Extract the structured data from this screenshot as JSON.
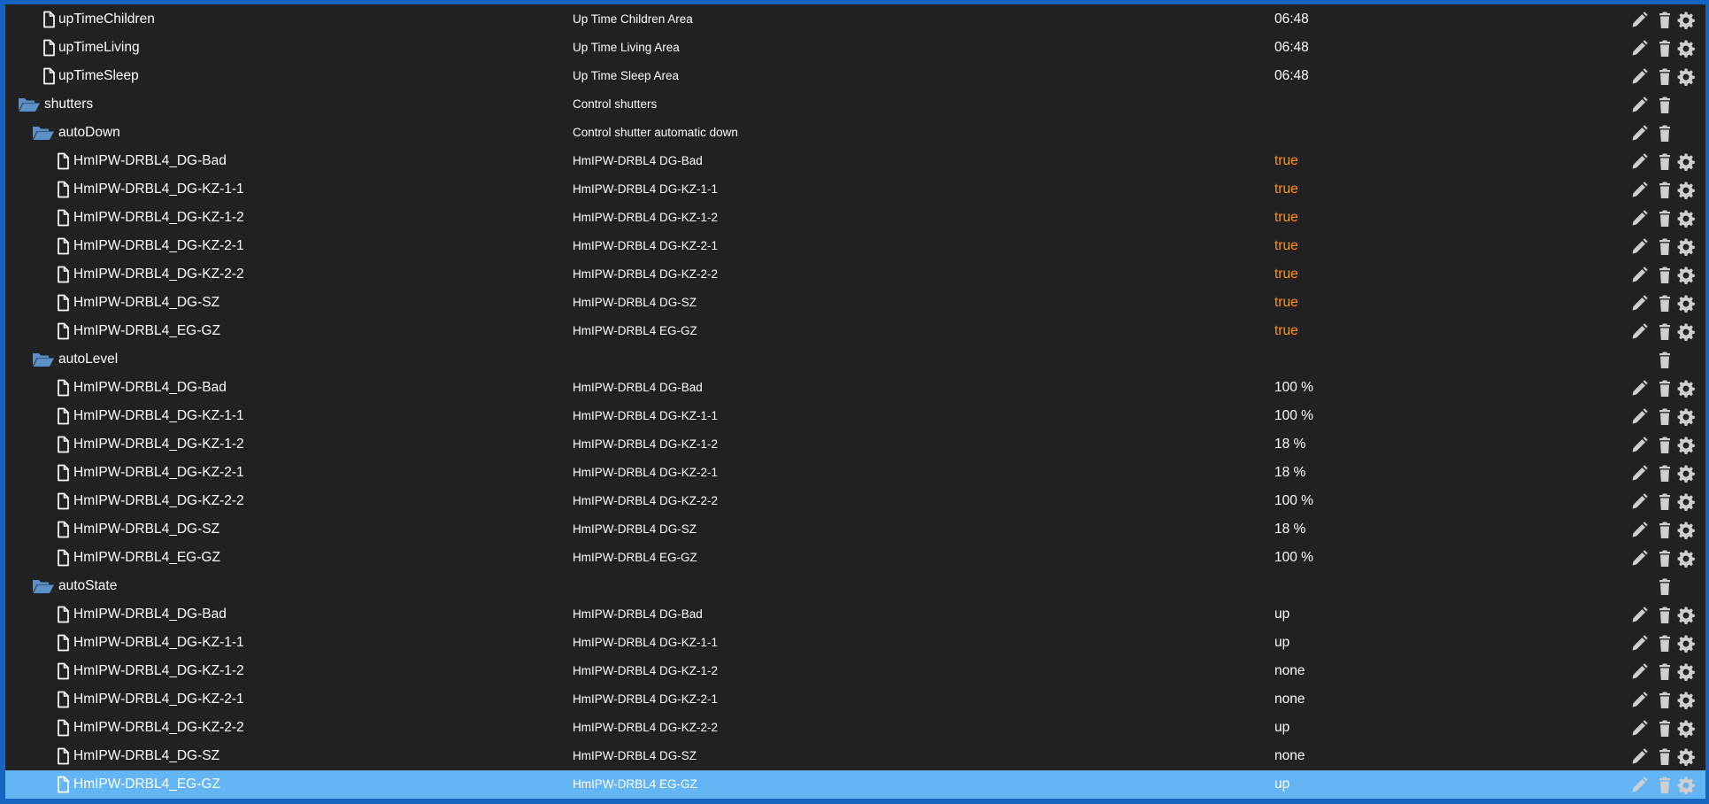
{
  "colors": {
    "frame_border": "#1565c0",
    "background": "#212121",
    "selected_row": "#64b5f6",
    "boolean_value": "#ff9800",
    "folder_icon": "#5b8fc7",
    "text": "#ffffff",
    "action_icon": "#cfcfcf"
  },
  "icons": {
    "file": "file-icon",
    "folder": "folder-open-icon",
    "edit": "pencil-icon",
    "delete": "trash-icon",
    "settings": "gear-icon"
  },
  "rows": [
    {
      "type": "state",
      "level": 1,
      "name": "upTimeChildren",
      "desc": "Up Time Children Area",
      "value": "06:48",
      "value_kind": "text",
      "actions": [
        "edit",
        "delete",
        "settings"
      ]
    },
    {
      "type": "state",
      "level": 1,
      "name": "upTimeLiving",
      "desc": "Up Time Living Area",
      "value": "06:48",
      "value_kind": "text",
      "actions": [
        "edit",
        "delete",
        "settings"
      ]
    },
    {
      "type": "state",
      "level": 1,
      "name": "upTimeSleep",
      "desc": "Up Time Sleep Area",
      "value": "06:48",
      "value_kind": "text",
      "actions": [
        "edit",
        "delete",
        "settings"
      ]
    },
    {
      "type": "folder",
      "level": 0,
      "name": "shutters",
      "desc": "Control shutters",
      "value": "",
      "value_kind": "text",
      "actions": [
        "edit",
        "delete"
      ]
    },
    {
      "type": "folder",
      "level": 1,
      "name": "autoDown",
      "desc": "Control shutter automatic down",
      "value": "",
      "value_kind": "text",
      "actions": [
        "edit",
        "delete"
      ]
    },
    {
      "type": "state",
      "level": 2,
      "name": "HmIPW-DRBL4_DG-Bad",
      "desc": "HmIPW-DRBL4 DG-Bad",
      "value": "true",
      "value_kind": "bool",
      "actions": [
        "edit",
        "delete",
        "settings"
      ]
    },
    {
      "type": "state",
      "level": 2,
      "name": "HmIPW-DRBL4_DG-KZ-1-1",
      "desc": "HmIPW-DRBL4 DG-KZ-1-1",
      "value": "true",
      "value_kind": "bool",
      "actions": [
        "edit",
        "delete",
        "settings"
      ]
    },
    {
      "type": "state",
      "level": 2,
      "name": "HmIPW-DRBL4_DG-KZ-1-2",
      "desc": "HmIPW-DRBL4 DG-KZ-1-2",
      "value": "true",
      "value_kind": "bool",
      "actions": [
        "edit",
        "delete",
        "settings"
      ]
    },
    {
      "type": "state",
      "level": 2,
      "name": "HmIPW-DRBL4_DG-KZ-2-1",
      "desc": "HmIPW-DRBL4 DG-KZ-2-1",
      "value": "true",
      "value_kind": "bool",
      "actions": [
        "edit",
        "delete",
        "settings"
      ]
    },
    {
      "type": "state",
      "level": 2,
      "name": "HmIPW-DRBL4_DG-KZ-2-2",
      "desc": "HmIPW-DRBL4 DG-KZ-2-2",
      "value": "true",
      "value_kind": "bool",
      "actions": [
        "edit",
        "delete",
        "settings"
      ]
    },
    {
      "type": "state",
      "level": 2,
      "name": "HmIPW-DRBL4_DG-SZ",
      "desc": "HmIPW-DRBL4 DG-SZ",
      "value": "true",
      "value_kind": "bool",
      "actions": [
        "edit",
        "delete",
        "settings"
      ]
    },
    {
      "type": "state",
      "level": 2,
      "name": "HmIPW-DRBL4_EG-GZ",
      "desc": "HmIPW-DRBL4 EG-GZ",
      "value": "true",
      "value_kind": "bool",
      "actions": [
        "edit",
        "delete",
        "settings"
      ]
    },
    {
      "type": "folder",
      "level": 1,
      "name": "autoLevel",
      "desc": "",
      "value": "",
      "value_kind": "text",
      "actions": [
        "delete"
      ]
    },
    {
      "type": "state",
      "level": 2,
      "name": "HmIPW-DRBL4_DG-Bad",
      "desc": "HmIPW-DRBL4 DG-Bad",
      "value": "100 %",
      "value_kind": "text",
      "actions": [
        "edit",
        "delete",
        "settings"
      ]
    },
    {
      "type": "state",
      "level": 2,
      "name": "HmIPW-DRBL4_DG-KZ-1-1",
      "desc": "HmIPW-DRBL4 DG-KZ-1-1",
      "value": "100 %",
      "value_kind": "text",
      "actions": [
        "edit",
        "delete",
        "settings"
      ]
    },
    {
      "type": "state",
      "level": 2,
      "name": "HmIPW-DRBL4_DG-KZ-1-2",
      "desc": "HmIPW-DRBL4 DG-KZ-1-2",
      "value": "18 %",
      "value_kind": "text",
      "actions": [
        "edit",
        "delete",
        "settings"
      ]
    },
    {
      "type": "state",
      "level": 2,
      "name": "HmIPW-DRBL4_DG-KZ-2-1",
      "desc": "HmIPW-DRBL4 DG-KZ-2-1",
      "value": "18 %",
      "value_kind": "text",
      "actions": [
        "edit",
        "delete",
        "settings"
      ]
    },
    {
      "type": "state",
      "level": 2,
      "name": "HmIPW-DRBL4_DG-KZ-2-2",
      "desc": "HmIPW-DRBL4 DG-KZ-2-2",
      "value": "100 %",
      "value_kind": "text",
      "actions": [
        "edit",
        "delete",
        "settings"
      ]
    },
    {
      "type": "state",
      "level": 2,
      "name": "HmIPW-DRBL4_DG-SZ",
      "desc": "HmIPW-DRBL4 DG-SZ",
      "value": "18 %",
      "value_kind": "text",
      "actions": [
        "edit",
        "delete",
        "settings"
      ]
    },
    {
      "type": "state",
      "level": 2,
      "name": "HmIPW-DRBL4_EG-GZ",
      "desc": "HmIPW-DRBL4 EG-GZ",
      "value": "100 %",
      "value_kind": "text",
      "actions": [
        "edit",
        "delete",
        "settings"
      ]
    },
    {
      "type": "folder",
      "level": 1,
      "name": "autoState",
      "desc": "",
      "value": "",
      "value_kind": "text",
      "actions": [
        "delete"
      ]
    },
    {
      "type": "state",
      "level": 2,
      "name": "HmIPW-DRBL4_DG-Bad",
      "desc": "HmIPW-DRBL4 DG-Bad",
      "value": "up",
      "value_kind": "text",
      "actions": [
        "edit",
        "delete",
        "settings"
      ]
    },
    {
      "type": "state",
      "level": 2,
      "name": "HmIPW-DRBL4_DG-KZ-1-1",
      "desc": "HmIPW-DRBL4 DG-KZ-1-1",
      "value": "up",
      "value_kind": "text",
      "actions": [
        "edit",
        "delete",
        "settings"
      ]
    },
    {
      "type": "state",
      "level": 2,
      "name": "HmIPW-DRBL4_DG-KZ-1-2",
      "desc": "HmIPW-DRBL4 DG-KZ-1-2",
      "value": "none",
      "value_kind": "text",
      "actions": [
        "edit",
        "delete",
        "settings"
      ]
    },
    {
      "type": "state",
      "level": 2,
      "name": "HmIPW-DRBL4_DG-KZ-2-1",
      "desc": "HmIPW-DRBL4 DG-KZ-2-1",
      "value": "none",
      "value_kind": "text",
      "actions": [
        "edit",
        "delete",
        "settings"
      ]
    },
    {
      "type": "state",
      "level": 2,
      "name": "HmIPW-DRBL4_DG-KZ-2-2",
      "desc": "HmIPW-DRBL4 DG-KZ-2-2",
      "value": "up",
      "value_kind": "text",
      "actions": [
        "edit",
        "delete",
        "settings"
      ]
    },
    {
      "type": "state",
      "level": 2,
      "name": "HmIPW-DRBL4_DG-SZ",
      "desc": "HmIPW-DRBL4 DG-SZ",
      "value": "none",
      "value_kind": "text",
      "actions": [
        "edit",
        "delete",
        "settings"
      ]
    },
    {
      "type": "state",
      "level": 2,
      "name": "HmIPW-DRBL4_EG-GZ",
      "desc": "HmIPW-DRBL4 EG-GZ",
      "value": "up",
      "value_kind": "text",
      "actions": [
        "edit",
        "delete",
        "settings"
      ],
      "selected": true
    }
  ]
}
